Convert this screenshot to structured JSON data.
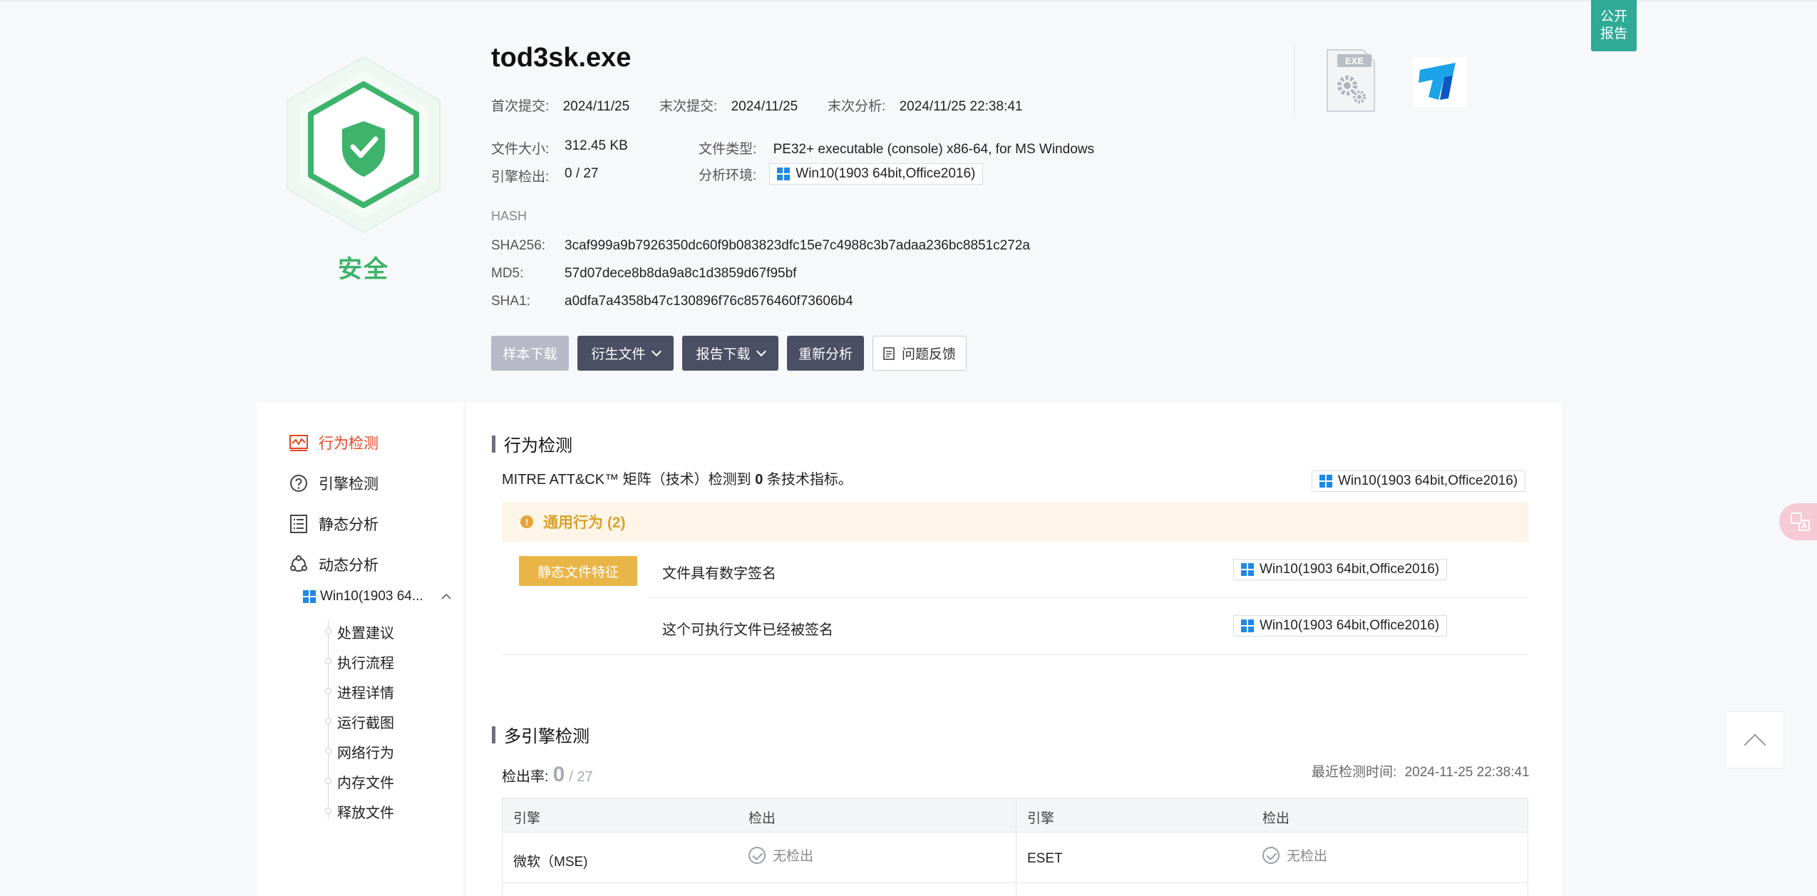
{
  "verdict": {
    "label": "安全"
  },
  "file": {
    "name": "tod3sk.exe",
    "first_submit_label": "首次提交:",
    "first_submit": "2024/11/25",
    "last_submit_label": "末次提交:",
    "last_submit": "2024/11/25",
    "last_analysis_label": "末次分析:",
    "last_analysis": "2024/11/25 22:38:41",
    "size_label": "文件大小:",
    "size": "312.45 KB",
    "type_label": "文件类型:",
    "type": "PE32+ executable (console) x86-64, for MS Windows",
    "engine_label": "引擎检出:",
    "engine": "0 / 27",
    "env_label": "分析环境:",
    "env": "Win10(1903 64bit,Office2016)"
  },
  "hash": {
    "heading": "HASH",
    "sha256_label": "SHA256:",
    "sha256": "3caf999a9b7926350dc60f9b083823dfc15e7c4988c3b7adaa236bc8851c272a",
    "md5_label": "MD5:",
    "md5": "57d07dece8b8da9a8c1d3859d67f95bf",
    "sha1_label": "SHA1:",
    "sha1": "a0dfa7a4358b47c130896f76c8576460f73606b4"
  },
  "actions": {
    "sample_download": "样本下载",
    "derived_files": "衍生文件",
    "report_download": "报告下载",
    "reanalyze": "重新分析",
    "feedback": "问题反馈"
  },
  "file_icon_text": "EXE",
  "public_report": [
    "公开",
    "报告"
  ],
  "sidebar": {
    "items": [
      {
        "label": "行为检测",
        "icon": "behavior-chart-icon",
        "active": true
      },
      {
        "label": "引擎检测",
        "icon": "question-circle-icon"
      },
      {
        "label": "静态分析",
        "icon": "list-doc-icon"
      },
      {
        "label": "动态分析",
        "icon": "cycle-icon"
      }
    ],
    "env_short": "Win10(1903 64...",
    "sub_items": [
      "处置建议",
      "执行流程",
      "进程详情",
      "运行截图",
      "网络行为",
      "内存文件",
      "释放文件"
    ]
  },
  "behavior": {
    "title": "行为检测",
    "mitre_prefix": "MITRE ATT&CK™ 矩阵（技术）检测到 ",
    "mitre_count": "0",
    "mitre_suffix": " 条技术指标。",
    "env": "Win10(1903 64bit,Office2016)",
    "general_title": "通用行为 (2)",
    "tag": "静态文件特征",
    "rows": [
      {
        "text": "文件具有数字签名",
        "env": "Win10(1903 64bit,Office2016)"
      },
      {
        "text": "这个可执行文件已经被签名",
        "env": "Win10(1903 64bit,Office2016)"
      }
    ]
  },
  "engines": {
    "title": "多引擎检测",
    "rate_label": "检出率:",
    "rate_value": "0",
    "rate_total": "/ 27",
    "last_time_label": "最近检测时间:",
    "last_time": "2024-11-25 22:38:41",
    "headers": [
      "引擎",
      "检出",
      "引擎",
      "检出"
    ],
    "rows": [
      {
        "engine1": "微软（MSE)",
        "result1": "无检出",
        "engine2": "ESET",
        "result2": "无检出"
      }
    ]
  },
  "colors": {
    "safe": "#3db36b",
    "active_nav": "#e4471f",
    "dark_button": "#4b4f63",
    "warning": "#d9a12c",
    "public_button": "#2eaa97"
  }
}
